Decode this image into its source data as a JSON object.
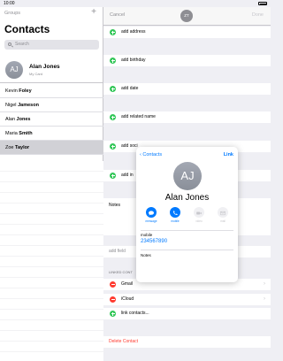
{
  "status": {
    "time": "10:00"
  },
  "sidebar": {
    "groups_label": "Groups",
    "add_glyph": "+",
    "title": "Contacts",
    "search_placeholder": "Search",
    "my_card": {
      "initials": "AJ",
      "name": "Alan Jones",
      "subtitle": "My Card"
    },
    "contacts": [
      {
        "first": "Kevin",
        "last": "Foley",
        "selected": false
      },
      {
        "first": "Nigel",
        "last": "Jameson",
        "selected": false
      },
      {
        "first": "Alan",
        "last": "Jones",
        "selected": false
      },
      {
        "first": "Maria",
        "last": "Smith",
        "selected": false
      },
      {
        "first": "Zoe",
        "last": "Taylor",
        "selected": true
      }
    ]
  },
  "editor": {
    "cancel_label": "Cancel",
    "done_label": "Done",
    "avatar_initials": "ZT",
    "add_rows": [
      "add address",
      "add birthday",
      "add date",
      "add related name",
      "add social profile",
      "add instant message"
    ],
    "add_rows_visible": [
      "add address",
      "add birthday",
      "add date",
      "add related name",
      "add soci",
      "add in"
    ],
    "notes_label": "Notes",
    "add_field_label": "add field",
    "linked_header": "LINKED CONTACTS",
    "linked_header_visible": "LINKED CONT",
    "linked": [
      "Gmail",
      "iCloud"
    ],
    "link_contacts_label": "link contacts...",
    "delete_label": "Delete Contact"
  },
  "popover": {
    "back_label": "Contacts",
    "link_label": "Link",
    "initials": "AJ",
    "name": "Alan Jones",
    "actions": [
      {
        "label": "message",
        "icon": "message-icon",
        "enabled": true
      },
      {
        "label": "mobile",
        "icon": "phone-icon",
        "enabled": true
      },
      {
        "label": "video",
        "icon": "video-icon",
        "enabled": false
      },
      {
        "label": "mail",
        "icon": "mail-icon",
        "enabled": false
      }
    ],
    "phone_label": "mobile",
    "phone_number": "234567890",
    "notes_label": "Notes"
  },
  "colors": {
    "accent": "#007aff",
    "add_green": "#34c759",
    "delete_red": "#ff3b30"
  }
}
